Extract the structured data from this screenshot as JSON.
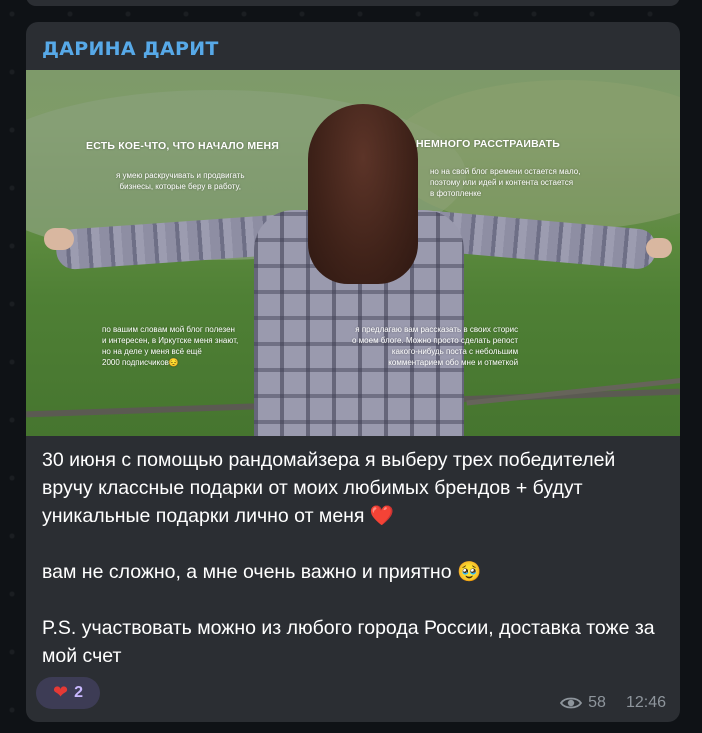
{
  "channel": {
    "name": "ДАРИНА ДАРИТ"
  },
  "photo": {
    "overlays": {
      "heading_left": "ЕСТЬ КОЕ-ЧТО, ЧТО НАЧАЛО МЕНЯ",
      "heading_right": "НЕМНОГО РАССТРАИВАТЬ",
      "sub_left_top": "я умею раскручивать и продвигать\nбизнесы, которые беру в работу,",
      "sub_right_top": "но на свой блог времени остается мало,\nпоэтому или идей и контента остается\nв фотопленке",
      "sub_left_bottom": "по вашим словам мой блог полезен\nи интересен, в Иркутске меня знают,\nно на деле у меня всё ещё\n2000 подписчиков😔",
      "sub_right_bottom": "я предлагаю вам рассказать в своих сторис\nо моем блоге. Можно просто сделать репост\nкакого-нибудь поста с небольшим\nкомментарием обо мне и отметкой"
    }
  },
  "message": {
    "text": "30 июня с помощью рандомайзера я выберу трех победителей вручу классные подарки от моих любимых брендов + будут уникальные подарки лично от меня ❤️\n\nвам не сложно, а мне очень важно и приятно 🥹\n\nP.S. участвовать можно из любого города России, доставка тоже за мой счет"
  },
  "reaction": {
    "emoji": "❤",
    "count": "2"
  },
  "meta": {
    "views": "58",
    "time": "12:46"
  },
  "colors": {
    "accent": "#57a9e8",
    "bubble": "#2b2e33",
    "meta": "#8e959c",
    "reaction_bg": "#3d3c55"
  }
}
